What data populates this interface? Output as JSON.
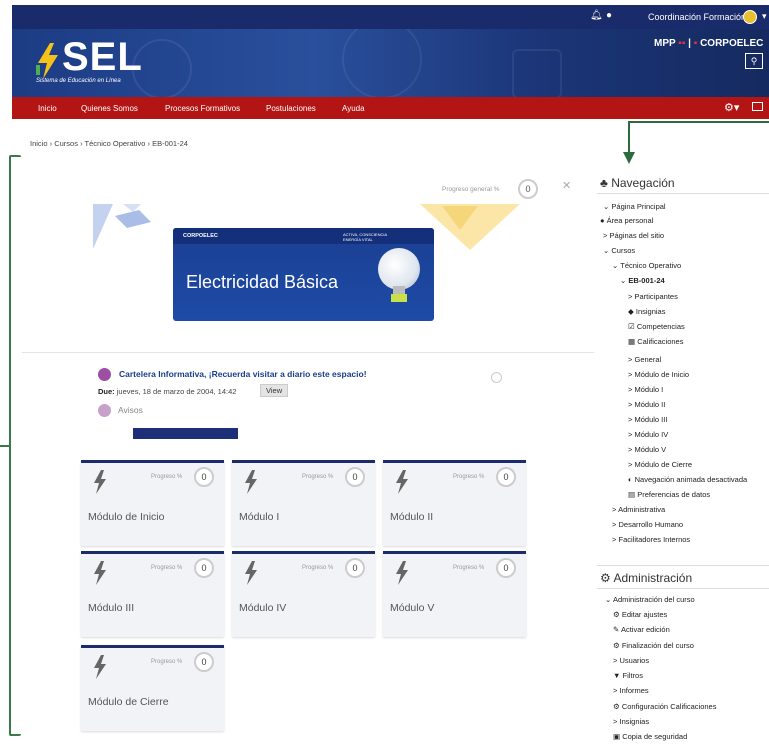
{
  "topbar": {
    "user_name": "Coordinación Formación"
  },
  "header": {
    "logo_text": "SEL",
    "logo_subtitle": "Sistema de Educación en Línea",
    "brand_mpp": "MPP",
    "brand_corp": "CORPOELEC"
  },
  "nav": {
    "items": [
      "Inicio",
      "Quienes Somos",
      "Procesos Formativos",
      "Postulaciones",
      "Ayuda"
    ]
  },
  "breadcrumb": {
    "items": [
      "Inicio",
      "Cursos",
      "Técnico Operativo",
      "EB-001-24"
    ],
    "sep": "›"
  },
  "course": {
    "progress_label": "Progreso general %",
    "progress_value": "0",
    "banner": {
      "company": "CORPOELEC",
      "tagline": "ACTIVA, CONSCIENCIA ENERGÍA VITAL",
      "title": "Electricidad Básica"
    }
  },
  "announcement": {
    "title": "Cartelera Informativa, ¡Recuerda visitar a diario este espacio!",
    "due_label": "Due:",
    "due_date": "jueves, 18 de marzo de 2004, 14:42",
    "view_label": "View",
    "avisos_label": "Avisos"
  },
  "tiles": {
    "progress_label": "Progreso %",
    "items": [
      {
        "name": "Módulo de Inicio",
        "progress": "0"
      },
      {
        "name": "Módulo I",
        "progress": "0"
      },
      {
        "name": "Módulo II",
        "progress": "0"
      },
      {
        "name": "Módulo III",
        "progress": "0"
      },
      {
        "name": "Módulo IV",
        "progress": "0"
      },
      {
        "name": "Módulo V",
        "progress": "0"
      },
      {
        "name": "Módulo de Cierre",
        "progress": "0"
      }
    ]
  },
  "navigation": {
    "title": "Navegación",
    "items": [
      {
        "prefix": "⌄",
        "label": "Página Principal"
      },
      {
        "prefix": "●",
        "label": "Área personal"
      },
      {
        "prefix": ">",
        "label": "Páginas del sitio"
      },
      {
        "prefix": "⌄",
        "label": "Cursos"
      },
      {
        "prefix": "⌄",
        "label": "Técnico Operativo"
      },
      {
        "prefix": "⌄",
        "label": "EB-001-24"
      },
      {
        "prefix": ">",
        "label": "Participantes"
      },
      {
        "prefix": "◆",
        "label": "Insignias"
      },
      {
        "prefix": "☑",
        "label": "Competencias"
      },
      {
        "prefix": "▦",
        "label": "Calificaciones"
      },
      {
        "prefix": ">",
        "label": "General"
      },
      {
        "prefix": ">",
        "label": "Módulo de Inicio"
      },
      {
        "prefix": ">",
        "label": "Módulo I"
      },
      {
        "prefix": ">",
        "label": "Módulo II"
      },
      {
        "prefix": ">",
        "label": "Módulo III"
      },
      {
        "prefix": ">",
        "label": "Módulo IV"
      },
      {
        "prefix": ">",
        "label": "Módulo V"
      },
      {
        "prefix": ">",
        "label": "Módulo de Cierre"
      },
      {
        "prefix": "◐",
        "label": "Navegación animada desactivada"
      },
      {
        "prefix": "▤",
        "label": "Preferencias de datos"
      },
      {
        "prefix": ">",
        "label": "Administrativa"
      },
      {
        "prefix": ">",
        "label": "Desarrollo Humano"
      },
      {
        "prefix": ">",
        "label": "Facilitadores Internos"
      }
    ]
  },
  "administration": {
    "title": "Administración",
    "items": [
      {
        "prefix": "⌄",
        "label": "Administración del curso"
      },
      {
        "prefix": "⚙",
        "label": "Editar ajustes"
      },
      {
        "prefix": "✎",
        "label": "Activar edición"
      },
      {
        "prefix": "⚙",
        "label": "Finalización del curso"
      },
      {
        "prefix": ">",
        "label": "Usuarios"
      },
      {
        "prefix": "▼",
        "label": "Filtros"
      },
      {
        "prefix": ">",
        "label": "Informes"
      },
      {
        "prefix": "⚙",
        "label": "Configuración Calificaciones"
      },
      {
        "prefix": ">",
        "label": "Insignias"
      },
      {
        "prefix": "▣",
        "label": "Copia de seguridad"
      }
    ]
  }
}
